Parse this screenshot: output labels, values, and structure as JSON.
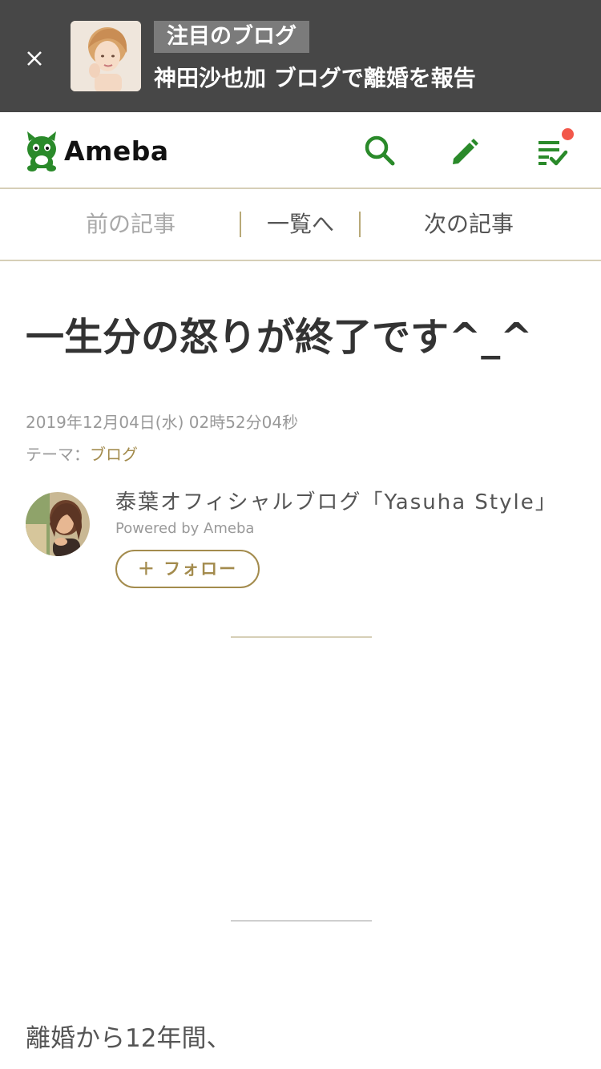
{
  "banner": {
    "badge": "注目のブログ",
    "title": "神田沙也加 ブログで離婚を報告",
    "close_icon": "close-icon",
    "background": "#474747"
  },
  "header": {
    "logo_text": "Ameba",
    "brand_color": "#2a8a2a",
    "icons": [
      "search-icon",
      "edit-pencil-icon",
      "notification-list-icon"
    ],
    "notification_dot_color": "#f2574a"
  },
  "article_nav": {
    "prev": "前の記事",
    "list": "一覧へ",
    "next": "次の記事"
  },
  "article": {
    "title": "一生分の怒りが終了です^_^",
    "date": "2019年12月04日(水) 02時52分04秒",
    "theme_label": "テーマ：",
    "theme_value": "ブログ",
    "body_first_line": "離婚から12年間、"
  },
  "author": {
    "blog_name": "泰葉オフィシャルブログ「Yasuha Style」",
    "powered_by": "Powered by Ameba",
    "follow_label": "＋ フォロー",
    "accent_color": "#a38b4d"
  }
}
